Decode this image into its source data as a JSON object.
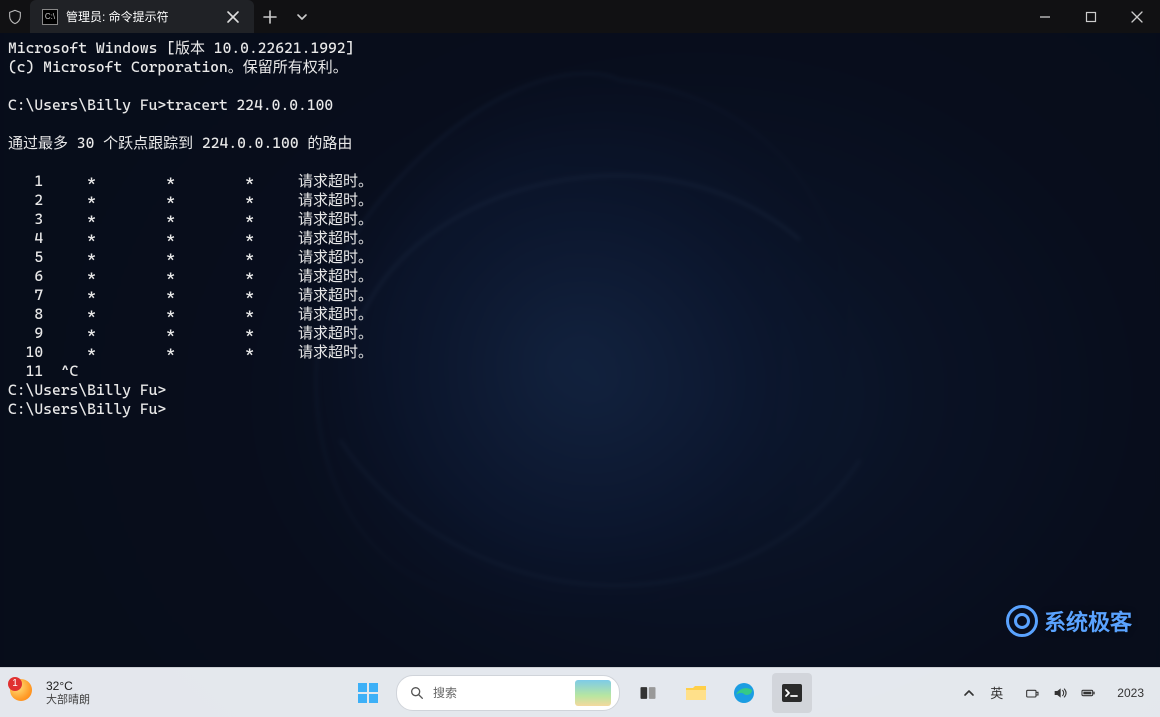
{
  "window": {
    "tab_title": "管理员: 命令提示符"
  },
  "terminal": {
    "line1": "Microsoft Windows [版本 10.0.22621.1992]",
    "line2": "(c) Microsoft Corporation。保留所有权利。",
    "prompt1": "C:\\Users\\Billy Fu>tracert 224.0.0.100",
    "trace_header": "通过最多 30 个跃点跟踪到 224.0.0.100 的路由",
    "timeout_msg": "请求超时。",
    "hops": [
      1,
      2,
      3,
      4,
      5,
      6,
      7,
      8,
      9,
      10
    ],
    "interrupt_line": "  11  ^C",
    "prompt2": "C:\\Users\\Billy Fu>",
    "prompt3": "C:\\Users\\Billy Fu>"
  },
  "watermark": {
    "text": "系统极客"
  },
  "taskbar": {
    "weather": {
      "badge": "1",
      "temp": "32°C",
      "desc": "大部晴朗"
    },
    "search_placeholder": "搜索",
    "ime": "英",
    "clock_bottom": "2023"
  }
}
